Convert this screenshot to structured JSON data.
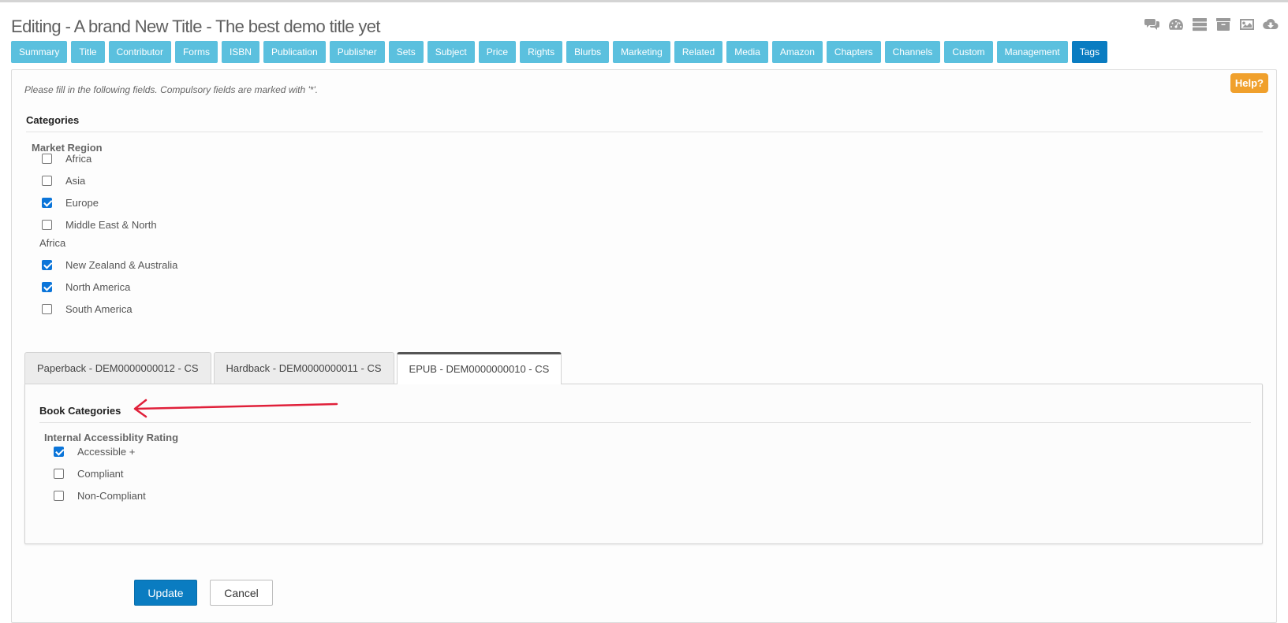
{
  "header": {
    "title": "Editing - A brand New Title - The best demo title yet",
    "icons": [
      "comments-icon",
      "dashboard-icon",
      "server-icon",
      "archive-icon",
      "image-icon",
      "cloud-download-icon"
    ]
  },
  "nav_tabs": [
    "Summary",
    "Title",
    "Contributor",
    "Forms",
    "ISBN",
    "Publication",
    "Publisher",
    "Sets",
    "Subject",
    "Price",
    "Rights",
    "Blurbs",
    "Marketing",
    "Related",
    "Media",
    "Amazon",
    "Chapters",
    "Channels",
    "Custom",
    "Management",
    "Tags"
  ],
  "active_nav_tab": "Tags",
  "help_label": "Help?",
  "instructions": "Please fill in the following fields. Compulsory fields are marked with '*'.",
  "categories": {
    "heading": "Categories",
    "market_region": {
      "label": "Market Region",
      "options": [
        {
          "label": "Africa",
          "checked": false
        },
        {
          "label": "Asia",
          "checked": false
        },
        {
          "label": "Europe",
          "checked": true
        },
        {
          "label": "Middle East & North",
          "checked": false
        },
        {
          "label": "New Zealand & Australia",
          "checked": true
        },
        {
          "label": "North America",
          "checked": true
        },
        {
          "label": "South America",
          "checked": false
        }
      ],
      "wrapped_text": "Africa"
    }
  },
  "format_tabs": [
    {
      "label": "Paperback - DEM0000000012 - CS",
      "active": false
    },
    {
      "label": "Hardback - DEM0000000011 - CS",
      "active": false
    },
    {
      "label": "EPUB - DEM0000000010 - CS",
      "active": true
    }
  ],
  "book_categories": {
    "heading": "Book Categories",
    "rating": {
      "label": "Internal Accessiblity Rating",
      "options": [
        {
          "label": "Accessible +",
          "checked": true
        },
        {
          "label": "Compliant",
          "checked": false
        },
        {
          "label": "Non-Compliant",
          "checked": false
        }
      ]
    }
  },
  "annotation_color": "#e0203a",
  "buttons": {
    "update": "Update",
    "cancel": "Cancel"
  }
}
